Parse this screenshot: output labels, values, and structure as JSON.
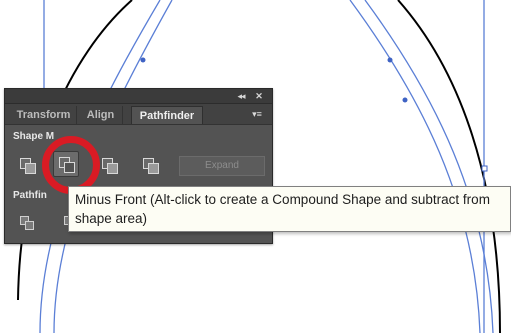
{
  "panel": {
    "collapse_glyph": "◂◂",
    "close_glyph": "✕",
    "menu_glyph": "▾≡",
    "tabs": [
      {
        "label": "Transform"
      },
      {
        "label": "Align"
      },
      {
        "label": "Pathfinder"
      }
    ],
    "shape_modes_label": "Shape M",
    "pathfinders_label": "Pathfin",
    "expand_label": "Expand"
  },
  "tooltip": {
    "line1": "Minus Front (Alt-click to create a Compound Shape and subtract from",
    "line2": "shape area)"
  },
  "colors": {
    "panel_bg": "#535353",
    "highlight_ring": "#d91b24",
    "guide_lines": "#5b7fd6",
    "outline": "#000000"
  },
  "icons": [
    "unite-icon",
    "minus-front-icon",
    "intersect-icon",
    "exclude-icon",
    "divide-icon",
    "trim-icon",
    "close-icon",
    "collapse-icon",
    "panel-menu-icon"
  ]
}
